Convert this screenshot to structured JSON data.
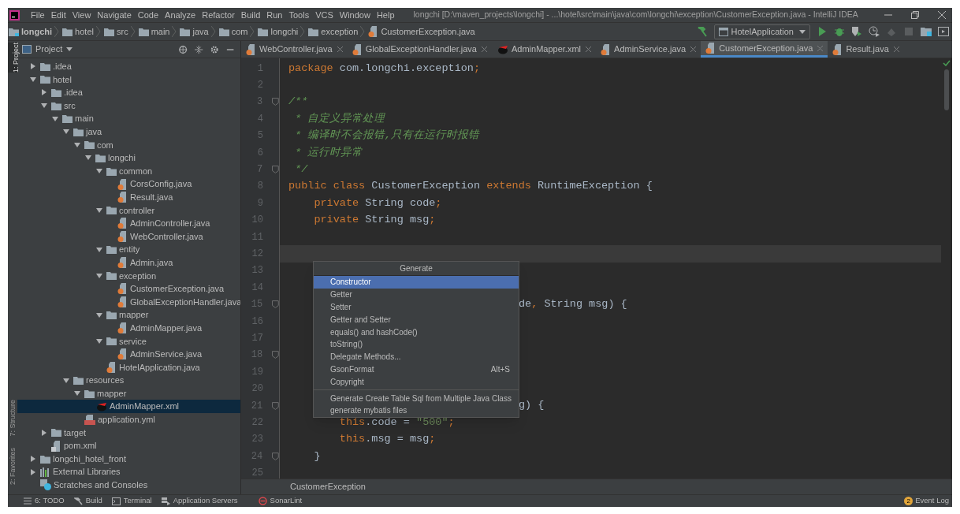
{
  "window": {
    "title": "longchi [D:\\maven_projects\\longchi] - ...\\hotel\\src\\main\\java\\com\\longchi\\exception\\CustomerException.java - IntelliJ IDEA"
  },
  "menu": [
    "File",
    "Edit",
    "View",
    "Navigate",
    "Code",
    "Analyze",
    "Refactor",
    "Build",
    "Run",
    "Tools",
    "VCS",
    "Window",
    "Help"
  ],
  "breadcrumbs": [
    {
      "label": "longchi",
      "kind": "project"
    },
    {
      "label": "hotel",
      "kind": "folder"
    },
    {
      "label": "src",
      "kind": "folder"
    },
    {
      "label": "main",
      "kind": "folder"
    },
    {
      "label": "java",
      "kind": "folder"
    },
    {
      "label": "com",
      "kind": "folder"
    },
    {
      "label": "longchi",
      "kind": "folder"
    },
    {
      "label": "exception",
      "kind": "folder"
    },
    {
      "label": "CustomerException.java",
      "kind": "java"
    }
  ],
  "run_config": "HotelApplication",
  "left_stripe": [
    {
      "label": "1: Project",
      "selected": true
    },
    {
      "label": "7: Structure",
      "selected": false
    },
    {
      "label": "2: Favorites",
      "selected": false
    }
  ],
  "project_panel": {
    "title": "Project",
    "tree": [
      {
        "label": ".idea",
        "kind": "folder",
        "expanded": false,
        "selected": false
      },
      {
        "label": "hotel",
        "kind": "folder",
        "expanded": true,
        "selected": false,
        "children": [
          {
            "label": ".idea",
            "kind": "folder",
            "expanded": false,
            "selected": false
          },
          {
            "label": "src",
            "kind": "folder",
            "expanded": true,
            "selected": false,
            "children": [
              {
                "label": "main",
                "kind": "folder",
                "expanded": true,
                "selected": false,
                "children": [
                  {
                    "label": "java",
                    "kind": "folder",
                    "expanded": true,
                    "selected": false,
                    "children": [
                      {
                        "label": "com",
                        "kind": "folder",
                        "expanded": true,
                        "selected": false,
                        "children": [
                          {
                            "label": "longchi",
                            "kind": "folder",
                            "expanded": true,
                            "selected": false,
                            "children": [
                              {
                                "label": "common",
                                "kind": "folder",
                                "expanded": true,
                                "selected": false,
                                "children": [
                                  {
                                    "label": "CorsConfig.java",
                                    "kind": "java",
                                    "selected": false
                                  },
                                  {
                                    "label": "Result.java",
                                    "kind": "java",
                                    "selected": false
                                  }
                                ]
                              },
                              {
                                "label": "controller",
                                "kind": "folder",
                                "expanded": true,
                                "selected": false,
                                "children": [
                                  {
                                    "label": "AdminController.java",
                                    "kind": "java",
                                    "selected": false
                                  },
                                  {
                                    "label": "WebController.java",
                                    "kind": "java",
                                    "selected": false
                                  }
                                ]
                              },
                              {
                                "label": "entity",
                                "kind": "folder",
                                "expanded": true,
                                "selected": false,
                                "children": [
                                  {
                                    "label": "Admin.java",
                                    "kind": "java",
                                    "selected": false
                                  }
                                ]
                              },
                              {
                                "label": "exception",
                                "kind": "folder",
                                "expanded": true,
                                "selected": false,
                                "children": [
                                  {
                                    "label": "CustomerException.java",
                                    "kind": "java",
                                    "selected": false
                                  },
                                  {
                                    "label": "GlobalExceptionHandler.java",
                                    "kind": "java",
                                    "selected": false
                                  }
                                ]
                              },
                              {
                                "label": "mapper",
                                "kind": "folder",
                                "expanded": true,
                                "selected": false,
                                "children": [
                                  {
                                    "label": "AdminMapper.java",
                                    "kind": "java",
                                    "selected": false
                                  }
                                ]
                              },
                              {
                                "label": "service",
                                "kind": "folder",
                                "expanded": true,
                                "selected": false,
                                "children": [
                                  {
                                    "label": "AdminService.java",
                                    "kind": "java",
                                    "selected": false
                                  }
                                ]
                              },
                              {
                                "label": "HotelApplication.java",
                                "kind": "java",
                                "selected": false
                              }
                            ]
                          }
                        ]
                      }
                    ]
                  },
                  {
                    "label": "resources",
                    "kind": "folder",
                    "expanded": true,
                    "selected": false,
                    "children": [
                      {
                        "label": "mapper",
                        "kind": "folder",
                        "expanded": true,
                        "selected": false,
                        "children": [
                          {
                            "label": "AdminMapper.xml",
                            "kind": "xml",
                            "selected": true
                          }
                        ]
                      },
                      {
                        "label": "application.yml",
                        "kind": "yml",
                        "selected": false
                      }
                    ]
                  }
                ]
              }
            ]
          },
          {
            "label": "target",
            "kind": "folder",
            "expanded": false,
            "selected": false
          },
          {
            "label": "pom.xml",
            "kind": "maven",
            "selected": false
          }
        ]
      },
      {
        "label": "longchi_hotel_front",
        "kind": "folder",
        "expanded": false,
        "selected": false
      },
      {
        "label": "External Libraries",
        "kind": "libraries",
        "expanded": false,
        "selected": false
      },
      {
        "label": "Scratches and Consoles",
        "kind": "scratches",
        "selected": false
      }
    ]
  },
  "tabs": [
    {
      "label": "WebController.java",
      "kind": "java",
      "selected": false
    },
    {
      "label": "GlobalExceptionHandler.java",
      "kind": "java",
      "selected": false
    },
    {
      "label": "AdminMapper.xml",
      "kind": "xml",
      "selected": false
    },
    {
      "label": "AdminService.java",
      "kind": "java",
      "selected": false
    },
    {
      "label": "CustomerException.java",
      "kind": "java",
      "selected": true
    },
    {
      "label": "Result.java",
      "kind": "java",
      "selected": false
    }
  ],
  "editor": {
    "lines": [
      {
        "number": "1",
        "fold": false,
        "current": false,
        "tokens": [
          {
            "text": "package ",
            "kind": "keyword"
          },
          {
            "text": "com.longchi.exception",
            "kind": "plain"
          },
          {
            "text": ";",
            "kind": "keyword"
          }
        ]
      },
      {
        "number": "2",
        "fold": false,
        "current": false
      },
      {
        "number": "3",
        "fold": true,
        "current": false,
        "tokens": [
          {
            "text": "/**",
            "kind": "comment"
          }
        ]
      },
      {
        "number": "4",
        "fold": false,
        "current": false,
        "tokens": [
          {
            "text": " * 自定义异常处理",
            "kind": "comment"
          }
        ]
      },
      {
        "number": "5",
        "fold": false,
        "current": false,
        "tokens": [
          {
            "text": " * 编译时不会报错,只有在运行时报错",
            "kind": "comment"
          }
        ]
      },
      {
        "number": "6",
        "fold": false,
        "current": false,
        "tokens": [
          {
            "text": " * 运行时异常",
            "kind": "comment"
          }
        ]
      },
      {
        "number": "7",
        "fold": true,
        "current": false,
        "tokens": [
          {
            "text": " */",
            "kind": "comment"
          }
        ]
      },
      {
        "number": "8",
        "fold": false,
        "current": false,
        "tokens": [
          {
            "text": "public class ",
            "kind": "keyword"
          },
          {
            "text": "CustomerException ",
            "kind": "plain"
          },
          {
            "text": "extends ",
            "kind": "keyword"
          },
          {
            "text": "RuntimeException {",
            "kind": "plain"
          }
        ]
      },
      {
        "number": "9",
        "fold": false,
        "current": false,
        "tokens": [
          {
            "text": "    private ",
            "kind": "keyword"
          },
          {
            "text": "String code",
            "kind": "plain"
          },
          {
            "text": ";",
            "kind": "keyword"
          }
        ]
      },
      {
        "number": "10",
        "fold": false,
        "current": false,
        "tokens": [
          {
            "text": "    private ",
            "kind": "keyword"
          },
          {
            "text": "String msg",
            "kind": "plain"
          },
          {
            "text": ";",
            "kind": "keyword"
          }
        ]
      },
      {
        "number": "11",
        "fold": false,
        "current": false
      },
      {
        "number": "12",
        "fold": false,
        "current": true
      },
      {
        "number": "13",
        "fold": false,
        "current": false
      },
      {
        "number": "14",
        "fold": false,
        "current": false
      },
      {
        "number": "15",
        "fold": true,
        "current": false,
        "behind_popup": true,
        "tokens": [
          {
            "text": "de",
            "kind": "plain"
          },
          {
            "text": ", ",
            "kind": "keyword"
          },
          {
            "text": "String msg) {",
            "kind": "plain"
          }
        ]
      },
      {
        "number": "16",
        "fold": false,
        "current": false
      },
      {
        "number": "17",
        "fold": false,
        "current": false
      },
      {
        "number": "18",
        "fold": true,
        "current": false
      },
      {
        "number": "19",
        "fold": false,
        "current": false
      },
      {
        "number": "20",
        "fold": false,
        "current": false
      },
      {
        "number": "21",
        "fold": true,
        "current": false,
        "behind_popup": true,
        "tokens": [
          {
            "text": "g) {",
            "kind": "plain"
          }
        ]
      },
      {
        "number": "22",
        "fold": false,
        "current": false,
        "tokens": [
          {
            "text": "        this",
            "kind": "keyword"
          },
          {
            "text": ".code = ",
            "kind": "plain"
          },
          {
            "text": "\"500\"",
            "kind": "string"
          },
          {
            "text": ";",
            "kind": "keyword"
          }
        ]
      },
      {
        "number": "23",
        "fold": false,
        "current": false,
        "tokens": [
          {
            "text": "        this",
            "kind": "keyword"
          },
          {
            "text": ".msg = msg",
            "kind": "plain"
          },
          {
            "text": ";",
            "kind": "keyword"
          }
        ]
      },
      {
        "number": "24",
        "fold": true,
        "current": false,
        "tokens": [
          {
            "text": "    }",
            "kind": "plain"
          }
        ]
      },
      {
        "number": "25",
        "fold": false,
        "current": false
      }
    ],
    "footer": "CustomerException"
  },
  "popup": {
    "title": "Generate",
    "items": [
      {
        "label": "Constructor",
        "selected": true,
        "separator_before": false
      },
      {
        "label": "Getter",
        "selected": false,
        "separator_before": false
      },
      {
        "label": "Setter",
        "selected": false,
        "separator_before": false
      },
      {
        "label": "Getter and Setter",
        "selected": false,
        "separator_before": false
      },
      {
        "label": "equals() and hashCode()",
        "selected": false,
        "separator_before": false
      },
      {
        "label": "toString()",
        "selected": false,
        "separator_before": false
      },
      {
        "label": "Delegate Methods...",
        "selected": false,
        "separator_before": false
      },
      {
        "label": "GsonFormat",
        "shortcut": "Alt+S",
        "selected": false,
        "separator_before": false
      },
      {
        "label": "Copyright",
        "selected": false,
        "separator_before": false
      },
      {
        "label": "Generate Create Table Sql from Multiple Java Class",
        "selected": false,
        "separator_before": true
      },
      {
        "label": "generate mybatis files",
        "selected": false,
        "separator_before": false
      }
    ]
  },
  "status_bar": {
    "tools": [
      {
        "label": "6: TODO",
        "kind": "list"
      },
      {
        "label": "Build",
        "kind": "hammer"
      },
      {
        "label": "Terminal",
        "kind": "terminal"
      },
      {
        "label": "Application Servers",
        "kind": "servers"
      },
      {
        "label": "SonarLint",
        "kind": "sonar"
      }
    ],
    "event_log": {
      "label": "Event Log",
      "count": "2"
    }
  }
}
